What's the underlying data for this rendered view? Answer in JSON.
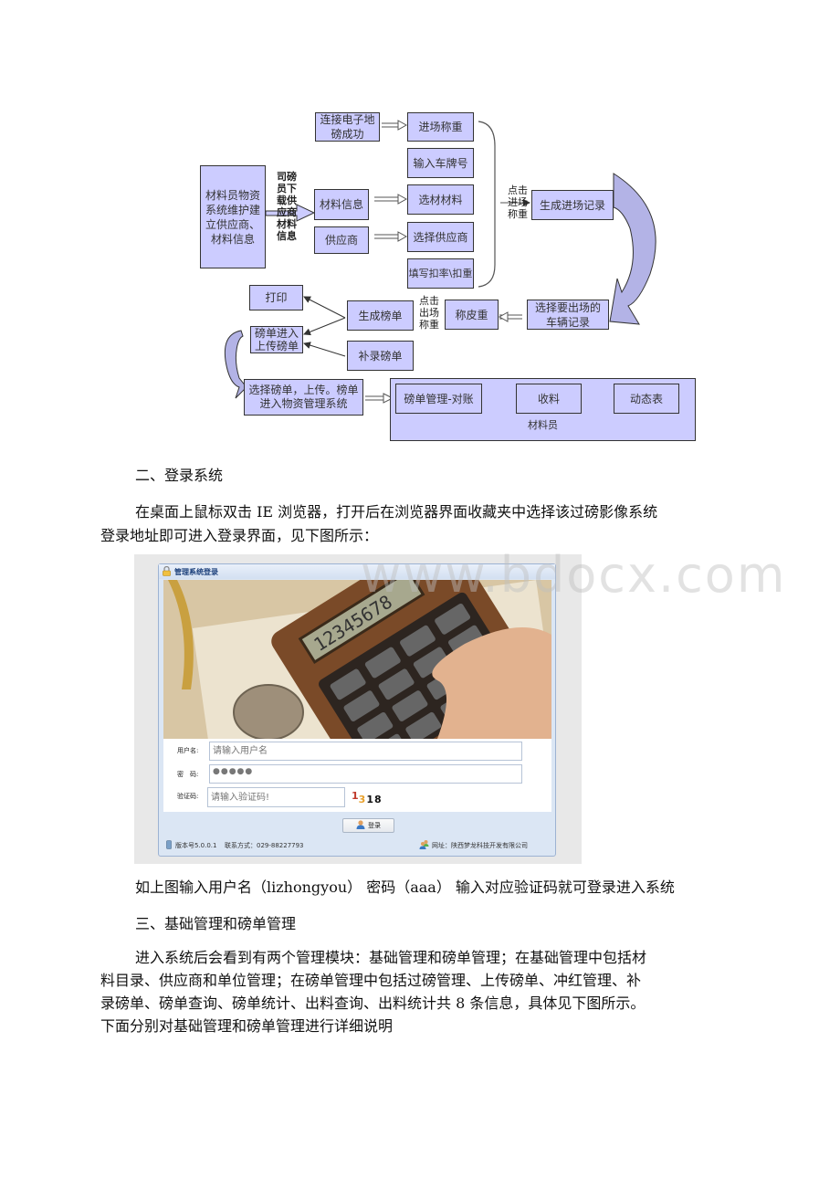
{
  "flowchart": {
    "boxes": {
      "source": "材料员物资系统维护建立供应商、材料信息",
      "download_label": "司磅员下载供应商材料信息",
      "material_info": "材料信息",
      "supplier": "供应商",
      "connect_scale": "连接电子地磅成功",
      "entry_weigh": "进场称重",
      "enter_plate": "输入车牌号",
      "select_material": "选材材料",
      "select_supplier": "选择供应商",
      "fill_deduction": "填写扣率\\扣重",
      "click_entry_label": "点击进场称重",
      "gen_entry_record": "生成进场记录",
      "select_exit_vehicle": "选择要出场的车辆记录",
      "tare_weigh": "称皮重",
      "click_exit_label": "点击出场称重",
      "gen_slip": "生成榜单",
      "print": "打印",
      "slip_upload": "磅单进入上传磅单",
      "supplement_slip": "补录磅单",
      "select_upload": "选择磅单，上传。榜单进入物资管理系统",
      "reconcile": "磅单管理-对账",
      "receive": "收料",
      "dynamic_table": "动态表",
      "material_clerk": "材料员"
    }
  },
  "section2": {
    "heading": "二、登录系统",
    "body_line1": "在桌面上鼠标双击 IE 浏览器，打开后在浏览器界面收藏夹中选择该过磅影像系统",
    "body_line2": "登录地址即可进入登录界面，见下图所示："
  },
  "login_window": {
    "title": "管理系统登录",
    "calculator_display": "12345678",
    "username_label": "用户名:",
    "username_placeholder": "请输入用户名",
    "password_label": "密　码:",
    "password_value": "●●●●●",
    "captcha_label": "验证码:",
    "captcha_placeholder": "请输入验证码!",
    "captcha_digits": [
      "1",
      "3",
      "1",
      "8"
    ],
    "captcha_colors": [
      "#c0392b",
      "#e8a02a",
      "#111111",
      "#111111"
    ],
    "login_button": "登录",
    "version": "版本号5.0.0.1",
    "contact": "联系方式：029-88227793",
    "website": "网址：陕西梦龙科技开发有限公司"
  },
  "watermark": "www.bdocx.com",
  "caption": "如上图输入用户名（lizhongyou） 密码（aaa） 输入对应验证码就可登录进入系统",
  "section3": {
    "heading": "三、基础管理和磅单管理",
    "lines": [
      "进入系统后会看到有两个管理模块：基础管理和磅单管理；在基础管理中包括材",
      "料目录、供应商和单位管理；在磅单管理中包括过磅管理、上传磅单、冲红管理、补",
      "录磅单、磅单查询、磅单统计、出料查询、出料统计共 8 条信息，具体见下图所示。",
      "下面分别对基础管理和磅单管理进行详细说明"
    ]
  }
}
